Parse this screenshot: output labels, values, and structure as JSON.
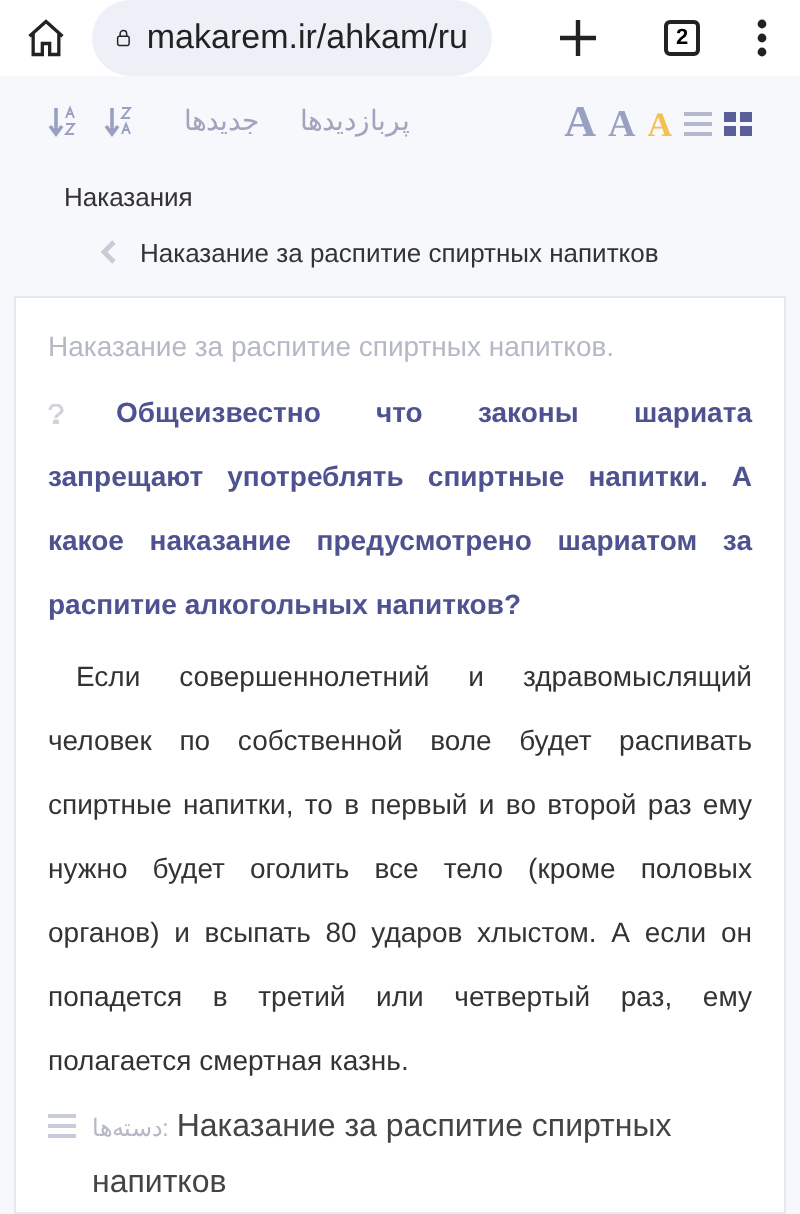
{
  "browser": {
    "url": "makarem.ir/ahkam/ru",
    "tab_count": "2"
  },
  "toolbar": {
    "sort_buttons": [
      {
        "kind": "az"
      },
      {
        "kind": "za"
      }
    ],
    "links": [
      "پربازدیدها",
      "جدیدها"
    ],
    "font_sizes": [
      {
        "label": "A",
        "kind": "large",
        "selected": false
      },
      {
        "label": "A",
        "kind": "medium",
        "selected": false
      },
      {
        "label": "A",
        "kind": "small",
        "selected": true
      }
    ],
    "views": [
      {
        "kind": "list",
        "selected": false
      },
      {
        "kind": "grid",
        "selected": true
      }
    ]
  },
  "breadcrumb": {
    "parent": "Наказания",
    "current": "Наказание за распитие спиртных напитков"
  },
  "article": {
    "title": "Наказание за распитие спиртных напитков.",
    "question": "Общеизвестно что законы шариата запрещают употреблять спиртные напитки. А какое наказание предусмотрено шариатом за распитие алкогольных напитков?",
    "answer": "Если совершеннолетний и здравомыслящий человек по собственной воле будет распивать спиртные напитки, то в первый и во второй раз ему нужно будет оголить все тело (кроме половых органов) и всыпать 80 ударов хлыстом. А если он попадется в третий или четвертый раз, ему полагается смертная казнь.",
    "category_label": "دسته‌ها:",
    "category": "Наказание за распитие спиртных напитков"
  }
}
